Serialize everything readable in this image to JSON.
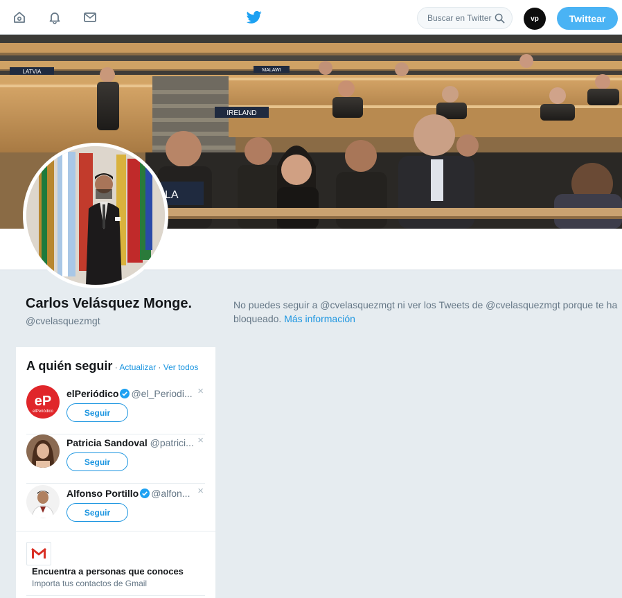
{
  "nav": {
    "home_icon": "home-icon",
    "notifications_icon": "bell-icon",
    "messages_icon": "envelope-icon",
    "logo_icon": "twitter-bird-icon",
    "search_placeholder": "Buscar en Twitter",
    "user_avatar_text": "vp",
    "tweet_button": "Twittear",
    "accent_color": "#1da1f2"
  },
  "banner": {
    "placard_latvia": "LATVIA",
    "placard_ireland": "IRELAND",
    "placard_malawi": "MALAWI",
    "placard_front": "LA"
  },
  "profile": {
    "name": "Carlos Velásquez Monge.",
    "handle": "@cvelasquezmgt",
    "blocked_text": "No puedes seguir a @cvelasquezmgt ni ver los Tweets de @cvelasquezmgt porque te ha bloqueado.",
    "blocked_link": "Más información"
  },
  "who_to_follow": {
    "title": "A quién seguir",
    "separator": " · ",
    "refresh": "Actualizar",
    "view_all": "Ver todos",
    "suggestions": [
      {
        "name": "elPeriódico",
        "handle": "@el_Periodi...",
        "verified": true,
        "button": "Seguir",
        "avatar_text": "eP",
        "avatar_subtext": "elPeriódico"
      },
      {
        "name": "Patricia Sandoval",
        "handle": "@patrici...",
        "verified": false,
        "button": "Seguir"
      },
      {
        "name": "Alfonso Portillo",
        "handle": "@alfon...",
        "verified": true,
        "button": "Seguir"
      }
    ],
    "dismiss": "×"
  },
  "find_people": {
    "icon": "gmail-icon",
    "title": "Encuentra a personas que conoces",
    "subtitle": "Importa tus contactos de Gmail"
  }
}
